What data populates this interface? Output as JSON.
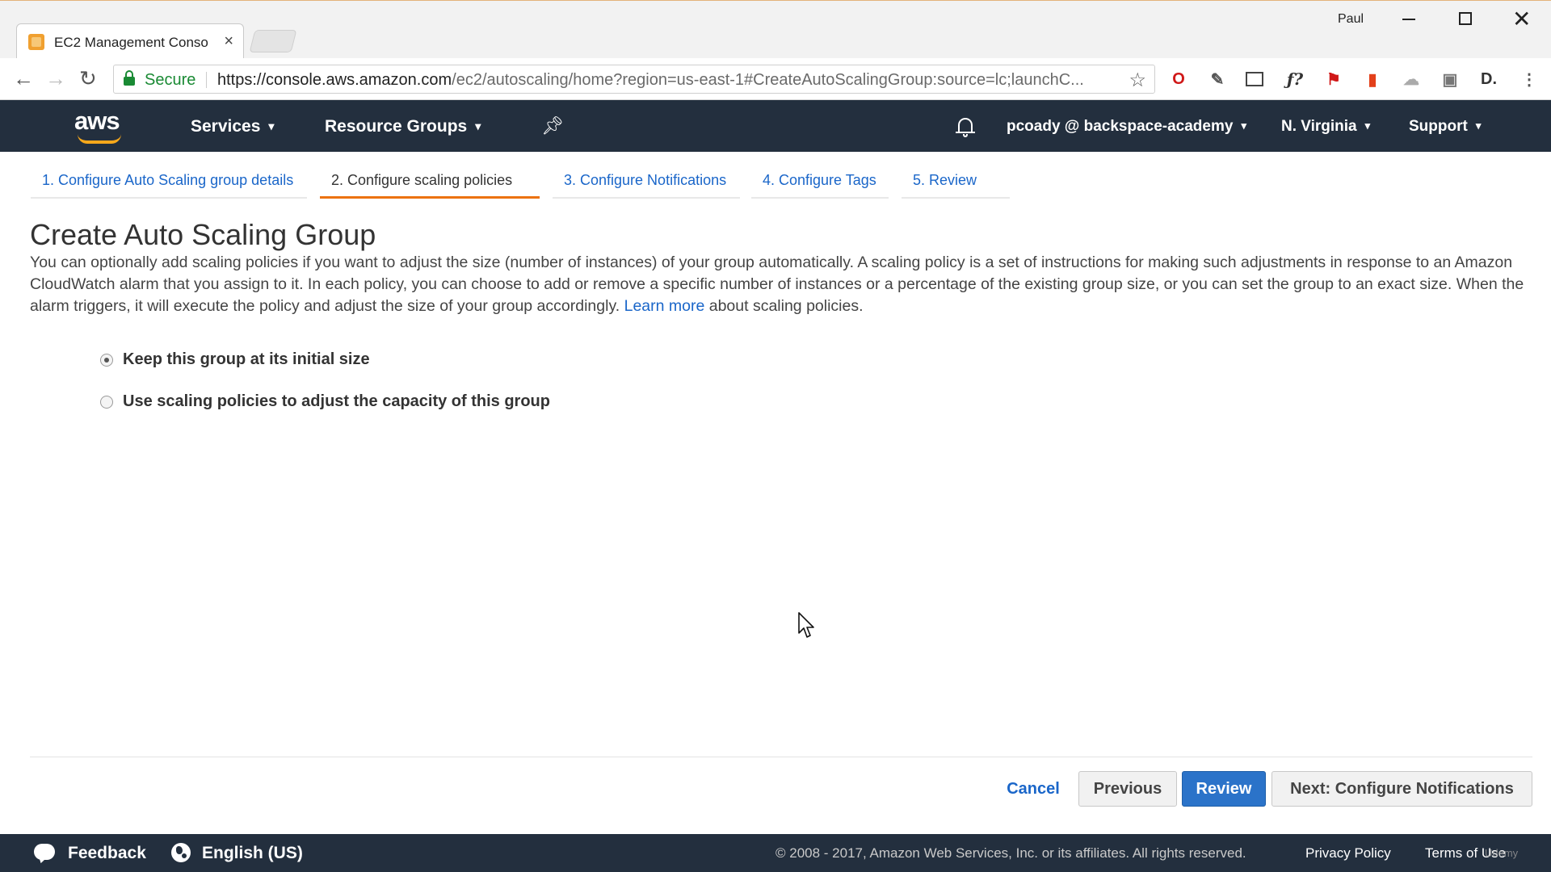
{
  "browser": {
    "tab_title": "EC2 Management Conso",
    "tab_close": "×",
    "user": "Paul",
    "secure_label": "Secure",
    "url_host": "https://console.aws.amazon.com",
    "url_path": "/ec2/autoscaling/home?region=us-east-1#CreateAutoScalingGroup:source=lc;launchC...",
    "icons": [
      "back-icon",
      "forward-icon",
      "reload-icon",
      "lock-icon",
      "star-icon",
      "opera-icon",
      "eyedropper-icon",
      "screenshot-icon",
      "fx-icon",
      "flag-icon",
      "office-icon",
      "cloud-icon",
      "puzzle-icon",
      "d-icon",
      "menu-icon"
    ]
  },
  "aws_header": {
    "logo": "aws",
    "services": "Services",
    "resource_groups": "Resource Groups",
    "account": "pcoady @ backspace-academy",
    "region": "N. Virginia",
    "support": "Support",
    "caret": "▾",
    "bg_color": "#232f3e",
    "accent": "#f7a81b"
  },
  "wizard": {
    "steps": [
      {
        "label": "1. Configure Auto Scaling group details",
        "active": false
      },
      {
        "label": "2. Configure scaling policies",
        "active": true
      },
      {
        "label": "3. Configure Notifications",
        "active": false
      },
      {
        "label": "4. Configure Tags",
        "active": false
      },
      {
        "label": "5. Review",
        "active": false
      }
    ],
    "active_color": "#ec7211"
  },
  "main": {
    "title": "Create Auto Scaling Group",
    "description": "You can optionally add scaling policies if you want to adjust the size (number of instances) of your group automatically. A scaling policy is a set of instructions for making such adjustments in response to an Amazon CloudWatch alarm that you assign to it. In each policy, you can choose to add or remove a specific number of instances or a percentage of the existing group size, or you can set the group to an exact size. When the alarm triggers, it will execute the policy and adjust the size of your group accordingly.",
    "learn_more": "Learn more",
    "description_tail": "about scaling policies.",
    "options": [
      {
        "label": "Keep this group at its initial size",
        "selected": true
      },
      {
        "label": "Use scaling policies to adjust the capacity of this group",
        "selected": false
      }
    ]
  },
  "buttons": {
    "cancel": "Cancel",
    "previous": "Previous",
    "review": "Review",
    "next": "Next: Configure Notifications",
    "primary_color": "#2b73c9"
  },
  "footer": {
    "feedback": "Feedback",
    "language": "English (US)",
    "copyright": "© 2008 - 2017, Amazon Web Services, Inc. or its affiliates. All rights reserved.",
    "privacy": "Privacy Policy",
    "terms": "Terms of Use",
    "watermark": "Udemy"
  }
}
